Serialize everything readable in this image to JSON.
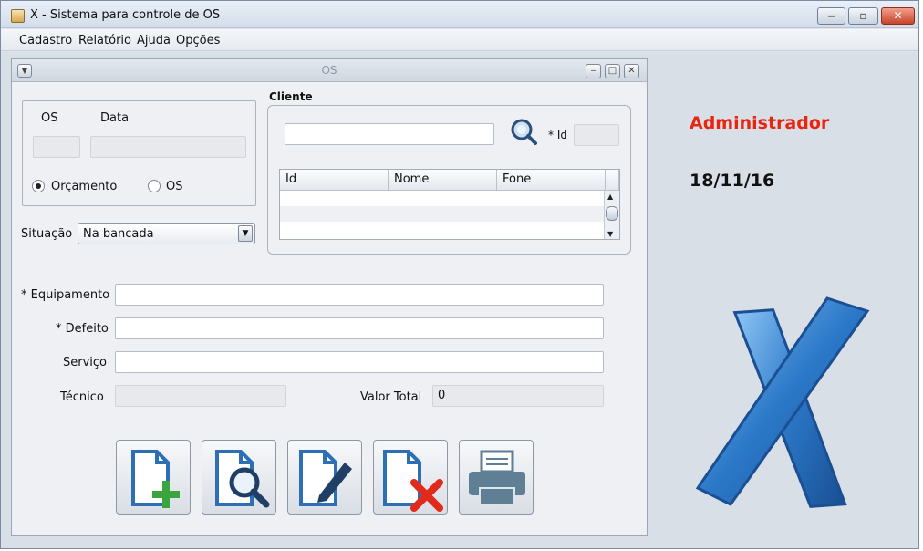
{
  "window": {
    "title": "X - Sistema para controle de OS",
    "controls": {
      "minimize": "‒",
      "maximize": "▫",
      "close": "✕"
    }
  },
  "menu": [
    "Cadastro",
    "Relatório",
    "Ajuda",
    "Opções"
  ],
  "frame": {
    "title": "OS",
    "os_panel": {
      "os_label": "OS",
      "data_label": "Data",
      "os_value": "",
      "data_value": "",
      "radio_orcamento": "Orçamento",
      "radio_os": "OS",
      "selected": "Orçamento"
    },
    "situacao": {
      "label": "Situação",
      "value": "Na bancada"
    },
    "cliente": {
      "title": "Cliente",
      "search_value": "",
      "id_label": "* Id",
      "id_value": "",
      "columns": [
        "Id",
        "Nome",
        "Fone"
      ]
    },
    "fields": {
      "equipamento_label": "* Equipamento",
      "equipamento_value": "",
      "defeito_label": "* Defeito",
      "defeito_value": "",
      "servico_label": "Serviço",
      "servico_value": "",
      "tecnico_label": "Técnico",
      "tecnico_value": "",
      "valor_label": "Valor Total",
      "valor_value": "0"
    },
    "toolbar_icons": [
      "add-os-icon",
      "search-os-icon",
      "edit-os-icon",
      "delete-os-icon",
      "print-os-icon"
    ]
  },
  "sidebar": {
    "user": "Administrador",
    "date": "18/11/16"
  },
  "colors": {
    "user_text": "#e8250f",
    "accent_blue": "#2b78c8",
    "add_green": "#3aa53e",
    "delete_red": "#e02a1c"
  }
}
